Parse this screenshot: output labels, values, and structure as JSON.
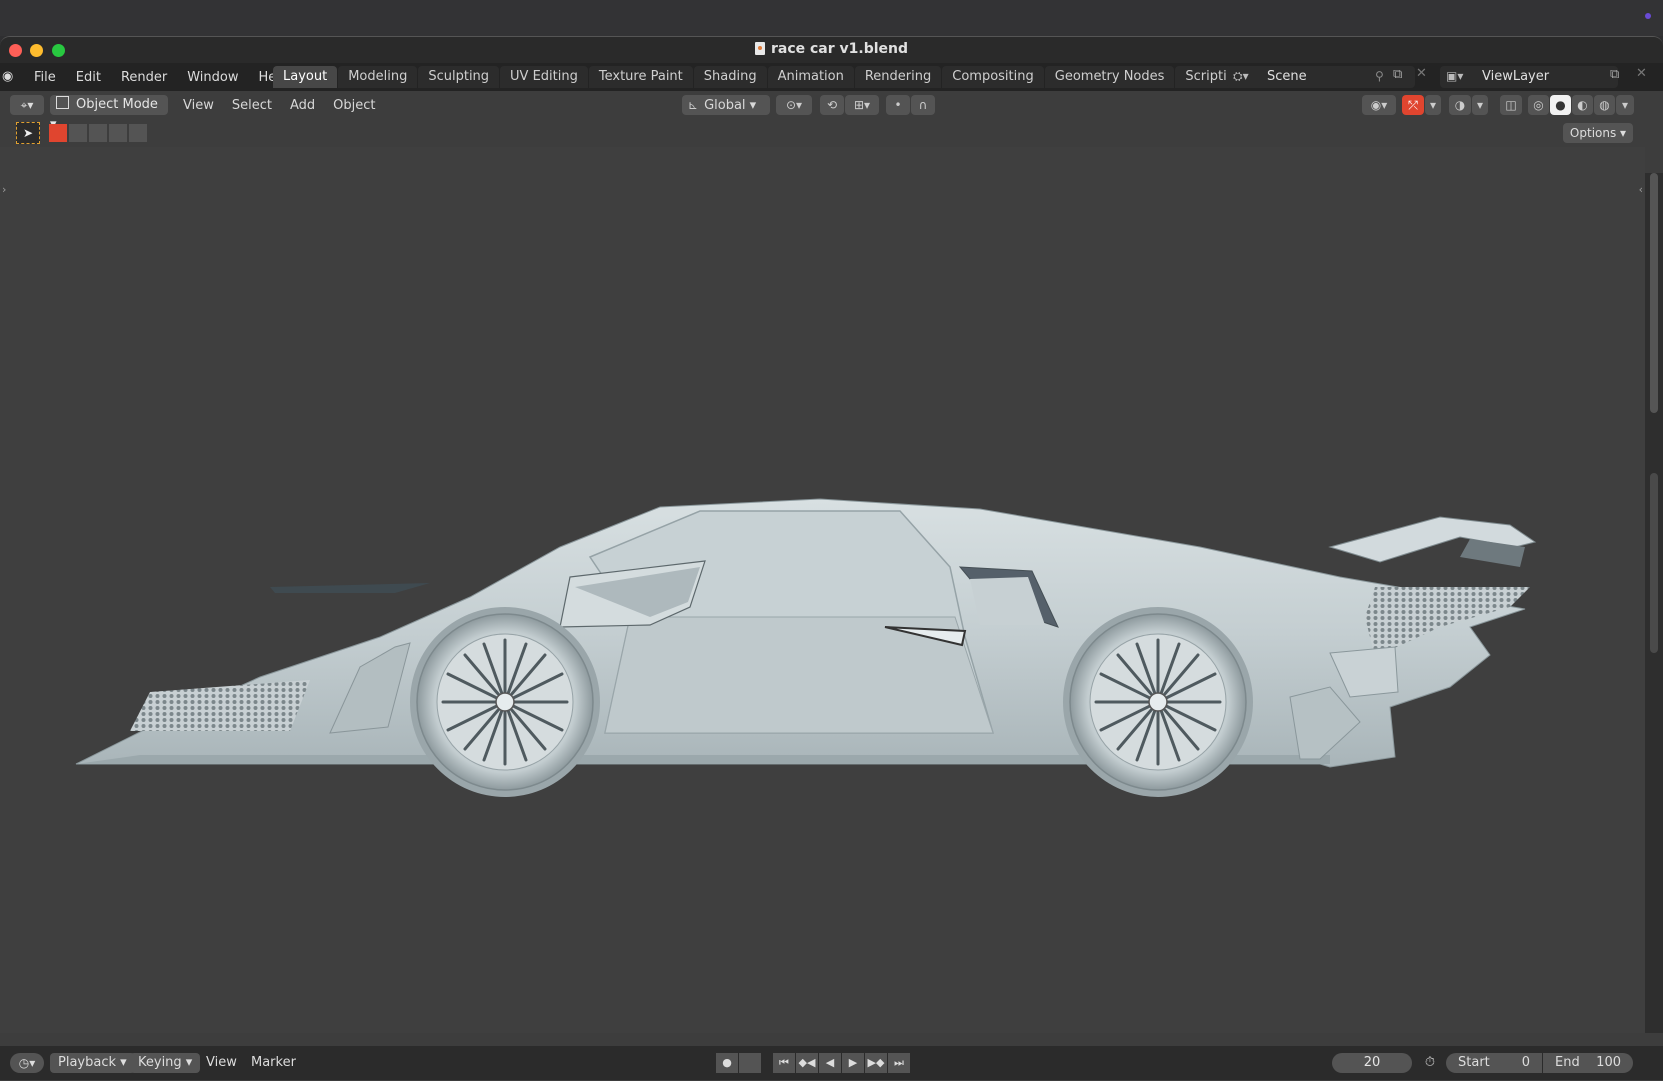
{
  "window": {
    "title": "race car v1.blend"
  },
  "topbar": {
    "menus": [
      "File",
      "Edit",
      "Render",
      "Window",
      "Help"
    ],
    "workspaces": [
      "Layout",
      "Modeling",
      "Sculpting",
      "UV Editing",
      "Texture Paint",
      "Shading",
      "Animation",
      "Rendering",
      "Compositing",
      "Geometry Nodes",
      "Scripting"
    ],
    "active_workspace": "Layout",
    "add_tab": "+",
    "scene": "Scene",
    "view_layer": "ViewLayer"
  },
  "viewport_header": {
    "mode": "Object Mode",
    "menus": [
      "View",
      "Select",
      "Add",
      "Object"
    ],
    "transform_orientation": "Global",
    "options_label": "Options"
  },
  "viewport": {
    "object": "race car",
    "background_color": "#3f3f3f",
    "car_color": "#c9d3d6"
  },
  "timeline": {
    "playback": "Playback",
    "keying": "Keying",
    "view": "View",
    "marker": "Marker",
    "current_frame": "20",
    "start_label": "Start",
    "start_value": "0",
    "end_label": "End",
    "end_value": "100"
  }
}
